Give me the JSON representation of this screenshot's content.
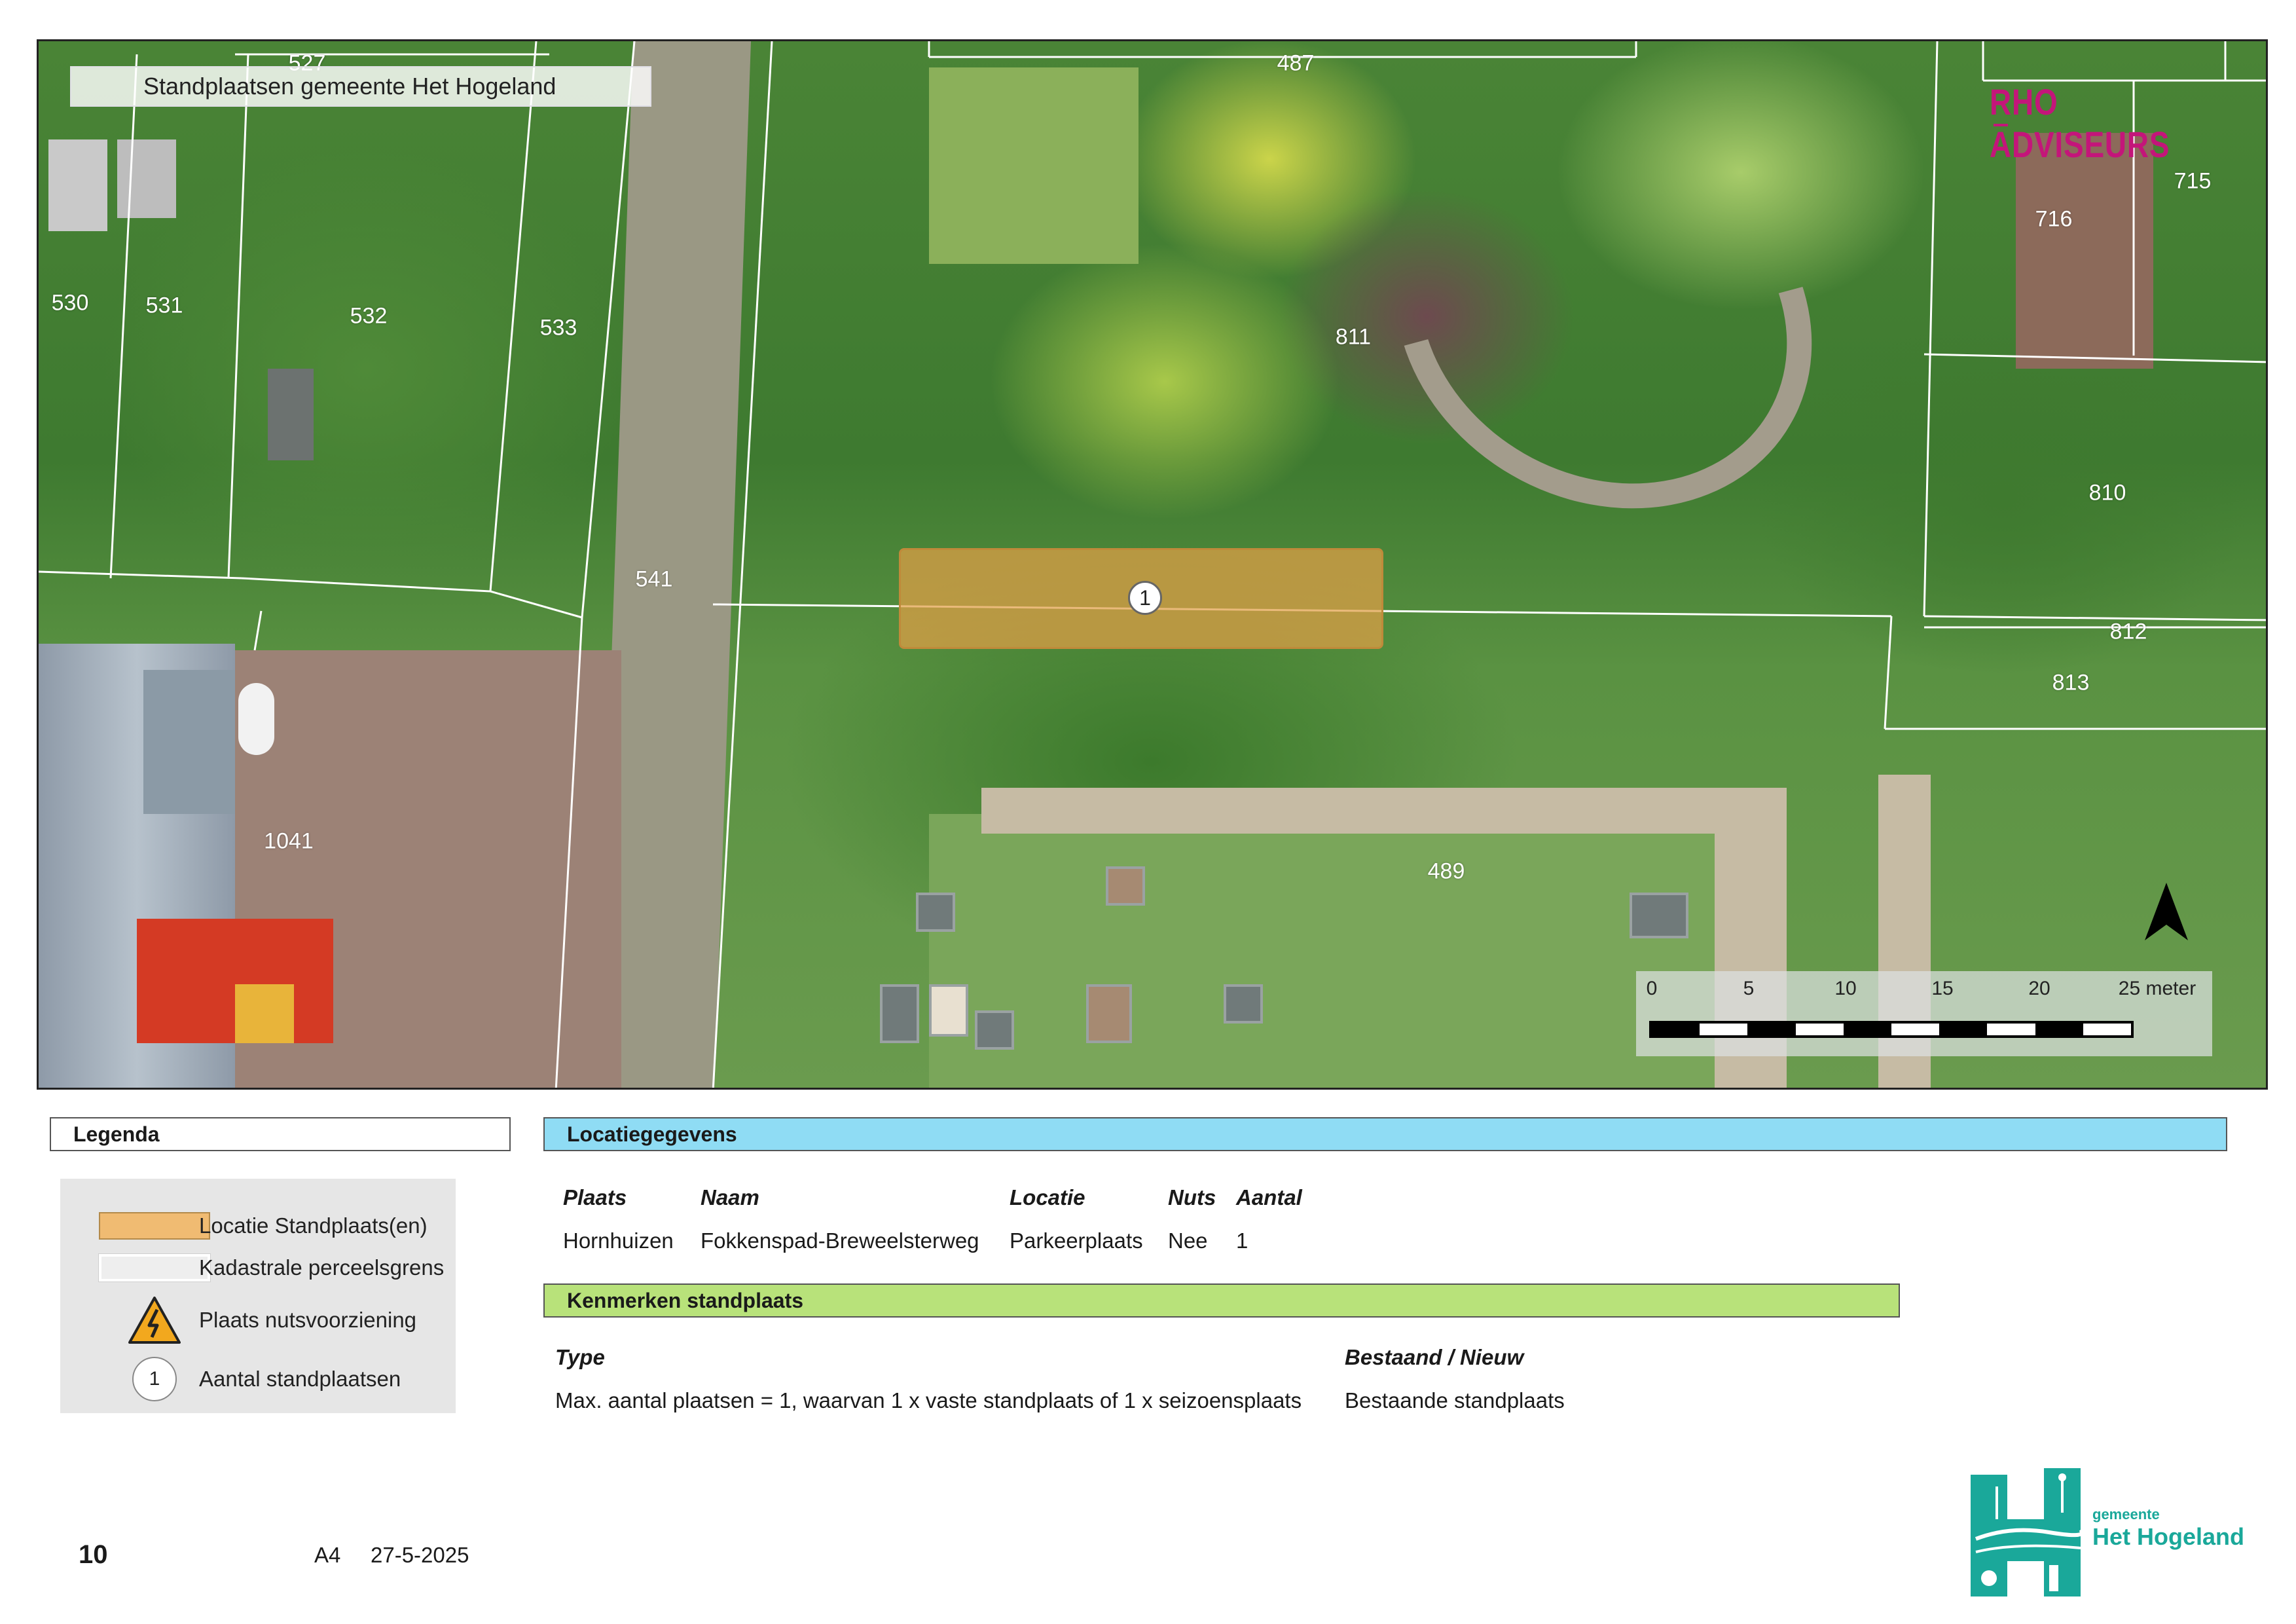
{
  "map": {
    "title": "Standplaatsen gemeente Het Hogeland",
    "brand": "RHO ADVISEURS",
    "standplaats_count_marker": "1",
    "parcel_numbers": [
      "527",
      "487",
      "530",
      "531",
      "532",
      "533",
      "716",
      "715",
      "811",
      "810",
      "541",
      "812",
      "813",
      "1041",
      "489"
    ],
    "scale": {
      "labels": [
        "0",
        "5",
        "10",
        "15",
        "20",
        "25 meter"
      ],
      "values_m": [
        0,
        5,
        10,
        15,
        20,
        25
      ]
    }
  },
  "legend": {
    "header": "Legenda",
    "items": [
      {
        "label": "Locatie Standplaats(en)",
        "symbol": "orange-area"
      },
      {
        "label": "Kadastrale perceelsgrens",
        "symbol": "white-outline"
      },
      {
        "label": "Plaats nutsvoorziening",
        "symbol": "warning-lightning-icon"
      },
      {
        "label": "Aantal standplaatsen",
        "symbol": "count-circle",
        "symbol_text": "1"
      }
    ]
  },
  "locatie": {
    "header": "Locatiegegevens",
    "columns": [
      "Plaats",
      "Naam",
      "Locatie",
      "Nuts",
      "Aantal"
    ],
    "values": [
      "Hornhuizen",
      "Fokkenspad-Breweelsterweg",
      "Parkeerplaats",
      "Nee",
      "1"
    ]
  },
  "kenmerken": {
    "header": "Kenmerken standplaats",
    "columns": [
      "Type",
      "Bestaand / Nieuw"
    ],
    "values": [
      "Max. aantal plaatsen = 1, waarvan 1 x vaste standplaats of 1 x seizoensplaats",
      "Bestaande standplaats"
    ]
  },
  "footer": {
    "page_number": "10",
    "paper_size": "A4",
    "date": "27-5-2025",
    "municipality_small": "gemeente",
    "municipality_name": "Het Hogeland"
  },
  "colors": {
    "standplaats": "#f0bb72",
    "locatie_header": "#8fdcf4",
    "kenmerken_header": "#b8e27a",
    "brand": "#c4157a",
    "municipality": "#1aa89a"
  }
}
